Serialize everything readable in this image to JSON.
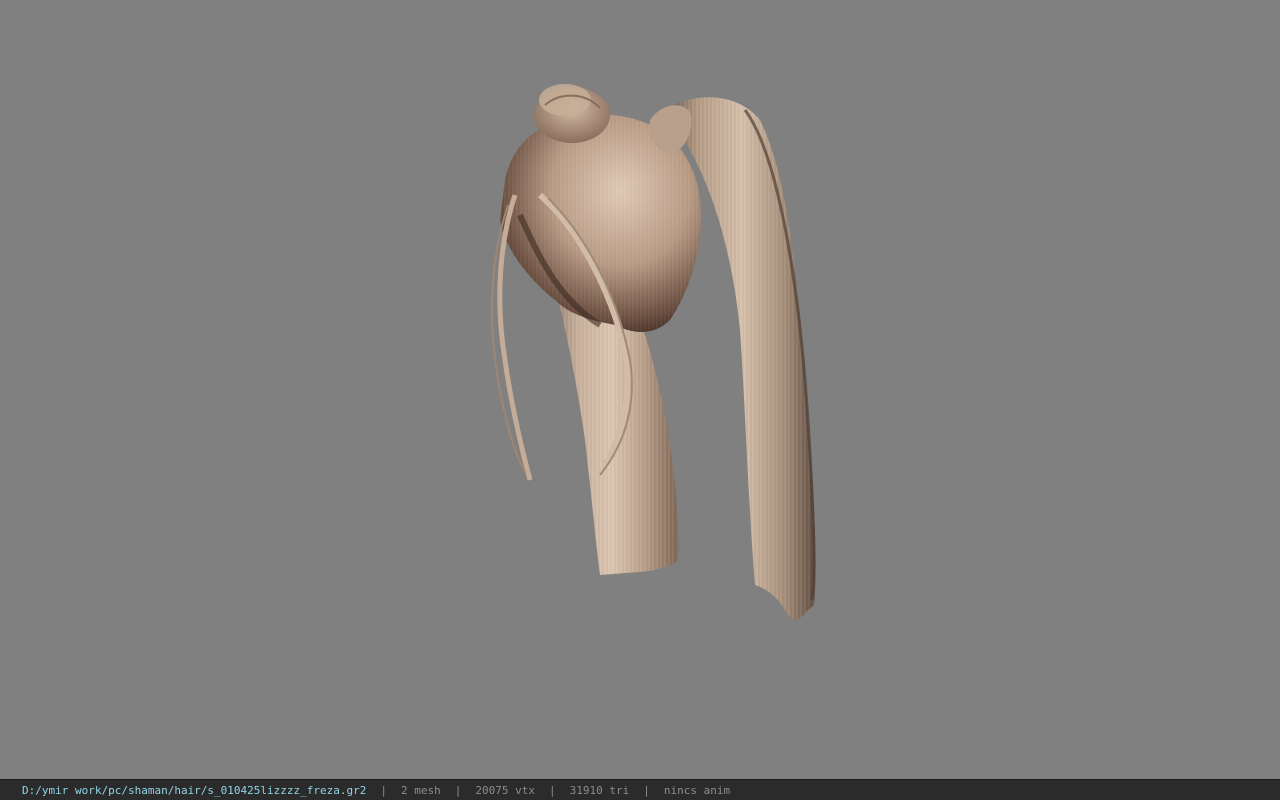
{
  "viewport": {
    "background_color": "#808080",
    "model": "hair-mesh"
  },
  "status_bar": {
    "file_path": "D:/ymir work/pc/shaman/hair/s_010425lizzzz_freza.gr2",
    "separator": "|",
    "mesh_count": "2 mesh",
    "vertex_count": "20075 vtx",
    "triangle_count": "31910 tri",
    "anim_status": "nincs anim",
    "path_color": "#8fd4e8",
    "text_color": "#8c8c8c"
  }
}
